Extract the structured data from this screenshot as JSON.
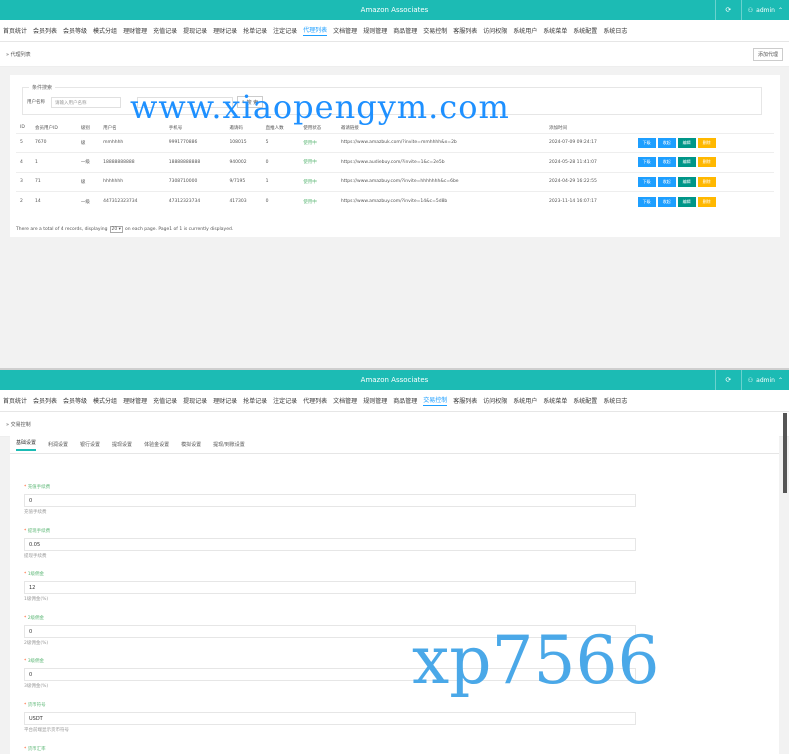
{
  "colors": {
    "topbar": "#1cbbb4",
    "primary": "#1e9fff",
    "teal": "#009688",
    "orange": "#ffb800",
    "status_green": "#5fb878"
  },
  "app_title": "Amazon Associates",
  "user": "admin",
  "nav_top": [
    "首页统计",
    "会员列表",
    "会员等级",
    "模式分组",
    "理财管理",
    "充值记录",
    "提现记录",
    "理财记录",
    "抢单记录",
    "注定记录",
    "代理列表",
    "文档管理",
    "规则管理",
    "商品管理",
    "交易控制",
    "客服列表",
    "访问权限",
    "系统用户",
    "系统菜单",
    "系统配置",
    "系统日志"
  ],
  "nav_bottom": [
    "首页统计",
    "会员列表",
    "会员等级",
    "模式分组",
    "理财管理",
    "充值记录",
    "提现记录",
    "理财记录",
    "抢单记录",
    "注定记录",
    "代理列表",
    "文档管理",
    "规则管理",
    "商品管理",
    "交易控制",
    "客服列表",
    "访问权限",
    "系统用户",
    "系统菜单",
    "系统配置",
    "系统日志"
  ],
  "agent_page": {
    "breadcrumb": "» 代理列表",
    "add_button": "添加代理",
    "search": {
      "legend": "条件搜索",
      "field_label": "用户名称",
      "placeholder": "请输入用户名称",
      "button": "搜 索"
    },
    "columns": [
      "ID",
      "会员用户ID",
      "级别",
      "用户名",
      "手机号",
      "邀请码",
      "直推人数",
      "使用状态",
      "邀请链接",
      "添加时间"
    ],
    "rows": [
      {
        "id": "5",
        "uid": "7670",
        "level": "级",
        "name": "mmhhhh",
        "phone": "9991770886",
        "code": "108015",
        "count": "5",
        "status": "使用中",
        "link": "https://www.amazbuk.com/?invite=mmhhhh&x=2b",
        "time": "2024-07-09 09:24:17"
      },
      {
        "id": "4",
        "uid": "1",
        "level": "一级",
        "name": "18888888888",
        "phone": "18888888888",
        "code": "940002",
        "count": "0",
        "status": "使用中",
        "link": "https://www.audiebuy.com/?invite=1&c=2e5b",
        "time": "2024-05-28 11:41:07"
      },
      {
        "id": "3",
        "uid": "71",
        "level": "级",
        "name": "hhhhhhh",
        "phone": "7308710000",
        "code": "9/7195",
        "count": "1",
        "status": "使用中",
        "link": "https://www.amazbuy.com/?invite=hhhhhhh&c=6be",
        "time": "2024-04-29 16:22:55"
      },
      {
        "id": "2",
        "uid": "14",
        "level": "一级",
        "name": "447312323734",
        "phone": "47312323734",
        "code": "417303",
        "count": "0",
        "status": "使用中",
        "link": "https://www.amazbuy.com/?invite=14&c=5d8b",
        "time": "2023-11-14 16:07:17"
      }
    ],
    "row_buttons": [
      "下级",
      "收起",
      "编辑",
      "删除"
    ],
    "footer_before": "There are a total of 4 records, displaying",
    "page_size": "20",
    "footer_after": "on each page. Page1 of 1 is currently displayed."
  },
  "trade_page": {
    "breadcrumb": "» 交易控制",
    "tabs": [
      "基础设置",
      "利润设置",
      "银行设置",
      "提现设置",
      "体验金设置",
      "模拟设置",
      "提现/到账设置"
    ],
    "fields": [
      {
        "label": "充值手续费",
        "value": "0",
        "help": "充值手续费"
      },
      {
        "label": "提现手续费",
        "value": "0.05",
        "help": "提现手续费"
      },
      {
        "label": "1级佣金",
        "value": "12",
        "help": "1级佣金(%)"
      },
      {
        "label": "2级佣金",
        "value": "0",
        "help": "2级佣金(%)"
      },
      {
        "label": "3级佣金",
        "value": "0",
        "help": "3级佣金(%)"
      },
      {
        "label": "货币符号",
        "value": "USDT",
        "help": "平台前端显示货币符号"
      },
      {
        "label": "货币汇率",
        "value": "",
        "help": ""
      }
    ]
  },
  "watermarks": {
    "top": "www.xiaopengym.com",
    "bottom": "xp7566"
  }
}
